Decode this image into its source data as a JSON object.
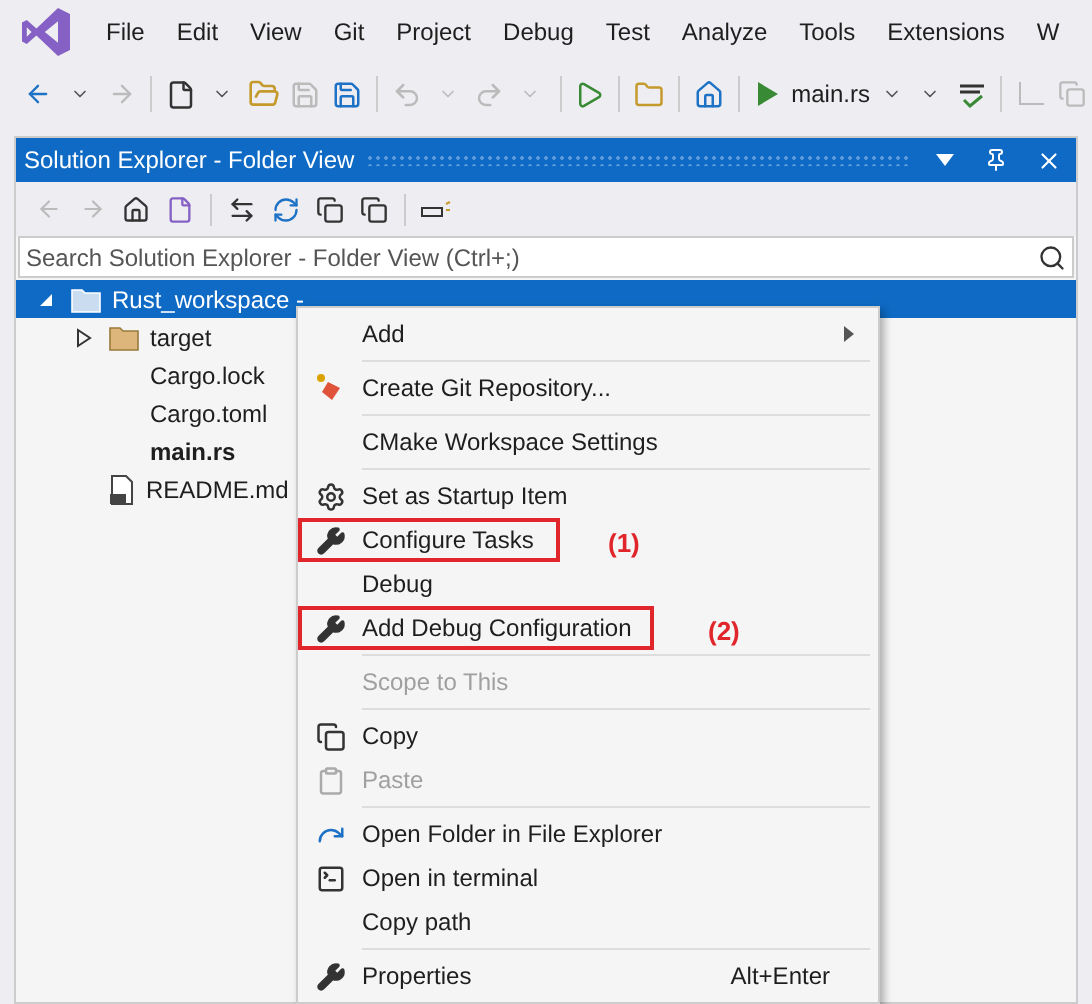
{
  "menu_bar": [
    "File",
    "Edit",
    "View",
    "Git",
    "Project",
    "Debug",
    "Test",
    "Analyze",
    "Tools",
    "Extensions",
    "W"
  ],
  "toolbar": {
    "run_target": "main.rs"
  },
  "panel": {
    "title": "Solution Explorer - Folder View",
    "search": {
      "placeholder": "Search Solution Explorer - Folder View (Ctrl+;)"
    },
    "tree": [
      {
        "label": "Rust_workspace -",
        "kind": "folder",
        "selected": true,
        "expanded": true,
        "children": [
          {
            "label": "target",
            "kind": "folder",
            "selected": false,
            "expanded": false
          },
          {
            "label": "Cargo.lock",
            "kind": "file",
            "selected": false,
            "bold": false
          },
          {
            "label": "Cargo.toml",
            "kind": "file",
            "selected": false,
            "bold": false
          },
          {
            "label": "main.rs",
            "kind": "file",
            "selected": false,
            "bold": true
          },
          {
            "label": "README.md",
            "kind": "markdown",
            "selected": false,
            "bold": false
          }
        ]
      }
    ]
  },
  "context_menu": [
    {
      "label": "Add",
      "submenu": true,
      "disabled": false
    },
    {
      "kind": "separator"
    },
    {
      "label": "Create Git Repository...",
      "disabled": false
    },
    {
      "kind": "separator"
    },
    {
      "label": "CMake Workspace Settings",
      "disabled": false
    },
    {
      "kind": "separator"
    },
    {
      "label": "Set as Startup Item",
      "disabled": false
    },
    {
      "label": "Configure Tasks",
      "disabled": false,
      "annotation": "(1)"
    },
    {
      "label": "Debug",
      "disabled": false
    },
    {
      "label": "Add Debug Configuration",
      "disabled": false,
      "annotation": "(2)"
    },
    {
      "kind": "separator"
    },
    {
      "label": "Scope to This",
      "disabled": true
    },
    {
      "kind": "separator"
    },
    {
      "label": "Copy",
      "disabled": false
    },
    {
      "label": "Paste",
      "disabled": true
    },
    {
      "kind": "separator"
    },
    {
      "label": "Open Folder in File Explorer",
      "disabled": false
    },
    {
      "label": "Open in terminal",
      "disabled": false
    },
    {
      "label": "Copy path",
      "disabled": false
    },
    {
      "kind": "separator"
    },
    {
      "label": "Properties",
      "disabled": false,
      "shortcut": "Alt+Enter"
    }
  ]
}
